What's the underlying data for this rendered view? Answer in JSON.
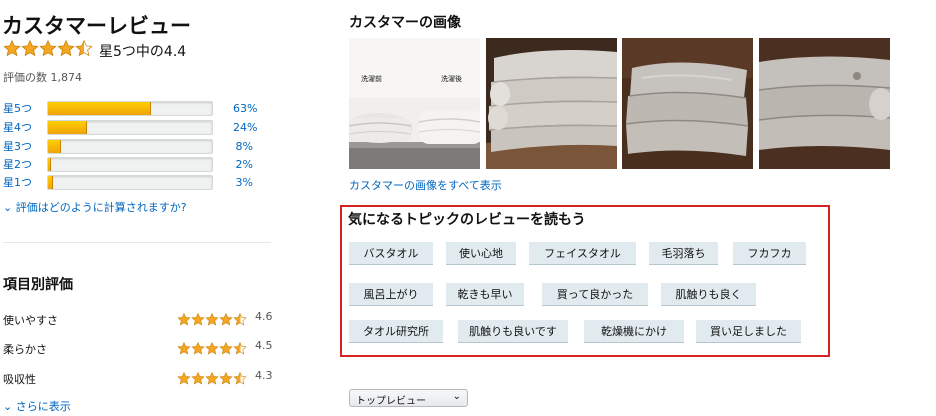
{
  "reviews": {
    "title": "カスタマーレビュー",
    "overall_text": "星5つ中の4.4",
    "overall_rating": 4.4,
    "count_text": "評価の数 1,874",
    "histogram": [
      {
        "label": "星5つ",
        "pct_text": "63%",
        "value": 63
      },
      {
        "label": "星4つ",
        "pct_text": "24%",
        "value": 24
      },
      {
        "label": "星3つ",
        "pct_text": "8%",
        "value": 8
      },
      {
        "label": "星2つ",
        "pct_text": "2%",
        "value": 2
      },
      {
        "label": "星1つ",
        "pct_text": "3%",
        "value": 3
      }
    ],
    "how_calculated": "評価はどのように計算されますか?",
    "by_feature": {
      "title": "項目別評価",
      "items": [
        {
          "name": "使いやすさ",
          "value": "4.6",
          "rating": 4.6
        },
        {
          "name": "柔らかさ",
          "value": "4.5",
          "rating": 4.5
        },
        {
          "name": "吸収性",
          "value": "4.3",
          "rating": 4.3
        }
      ],
      "see_more": "さらに表示"
    }
  },
  "images": {
    "title": "カスタマーの画像",
    "photo1_labels": {
      "before": "洗濯前",
      "after": "洗濯後"
    },
    "see_all": "カスタマーの画像をすべて表示"
  },
  "topics": {
    "title": "気になるトピックのレビューを読もう",
    "rows": [
      [
        "バスタオル",
        "使い心地",
        "フェイスタオル",
        "毛羽落ち",
        "フカフカ"
      ],
      [
        "風呂上がり",
        "乾きも早い",
        "買って良かった",
        "肌触りも良く"
      ],
      [
        "タオル研究所",
        "肌触りも良いです",
        "乾燥機にかけ",
        "買い足しました"
      ]
    ]
  },
  "sort": {
    "selected": "トップレビュー"
  },
  "colors": {
    "star": "#f5a623",
    "link": "#0066c0",
    "highlight_border": "#d62424",
    "pill_bg": "#e1ebef"
  }
}
